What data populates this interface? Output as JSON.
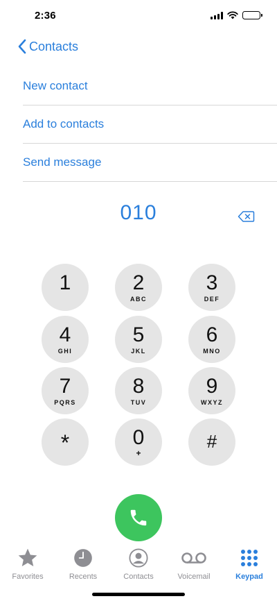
{
  "status_bar": {
    "time": "2:36"
  },
  "nav": {
    "back_label": "Contacts"
  },
  "actions": [
    {
      "label": "New contact"
    },
    {
      "label": "Add to contacts"
    },
    {
      "label": "Send message"
    }
  ],
  "dialed_number": "010",
  "keypad": {
    "keys": [
      {
        "digit": "1",
        "letters": ""
      },
      {
        "digit": "2",
        "letters": "ABC"
      },
      {
        "digit": "3",
        "letters": "DEF"
      },
      {
        "digit": "4",
        "letters": "GHI"
      },
      {
        "digit": "5",
        "letters": "JKL"
      },
      {
        "digit": "6",
        "letters": "MNO"
      },
      {
        "digit": "7",
        "letters": "PQRS"
      },
      {
        "digit": "8",
        "letters": "TUV"
      },
      {
        "digit": "9",
        "letters": "WXYZ"
      },
      {
        "digit": "*",
        "letters": ""
      },
      {
        "digit": "0",
        "letters": "+"
      },
      {
        "digit": "#",
        "letters": ""
      }
    ]
  },
  "tabs": [
    {
      "label": "Favorites",
      "icon": "star-icon"
    },
    {
      "label": "Recents",
      "icon": "clock-icon"
    },
    {
      "label": "Contacts",
      "icon": "person-icon"
    },
    {
      "label": "Voicemail",
      "icon": "voicemail-icon"
    },
    {
      "label": "Keypad",
      "icon": "keypad-icon",
      "active": true
    }
  ],
  "colors": {
    "accent": "#2a7fdc",
    "call_green": "#3dc55e",
    "key_background": "#e5e5e5",
    "inactive_tab": "#8e8e93"
  }
}
